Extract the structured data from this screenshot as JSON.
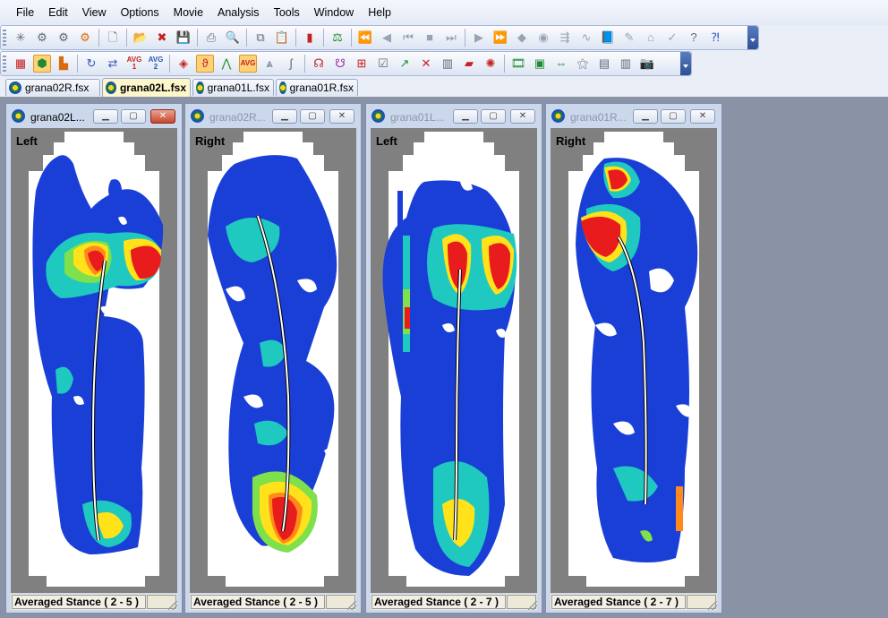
{
  "menu": [
    "File",
    "Edit",
    "View",
    "Options",
    "Movie",
    "Analysis",
    "Tools",
    "Window",
    "Help"
  ],
  "toolbar1": [
    {
      "icon": "asterisk-icon",
      "glyph": "✳",
      "cls": "ic-grey"
    },
    {
      "icon": "gears-icon",
      "glyph": "⚙",
      "cls": "ic-grey"
    },
    {
      "icon": "gear-settings-icon",
      "glyph": "⚙",
      "cls": "ic-grey"
    },
    {
      "icon": "key-gear-icon",
      "glyph": "⚙",
      "cls": "ic-org"
    },
    {
      "sep": true
    },
    {
      "icon": "new-file-icon",
      "glyph": "🗋",
      "cls": "ic-grey"
    },
    {
      "sep": true
    },
    {
      "icon": "open-folder-icon",
      "glyph": "📂",
      "cls": "ic-org"
    },
    {
      "icon": "close-file-icon",
      "glyph": "✖",
      "cls": "ic-red"
    },
    {
      "icon": "save-icon",
      "glyph": "💾",
      "cls": "ic-dis"
    },
    {
      "sep": true
    },
    {
      "icon": "print-icon",
      "glyph": "⎙",
      "cls": "ic-grey"
    },
    {
      "icon": "print-preview-icon",
      "glyph": "🔍",
      "cls": "ic-grey"
    },
    {
      "sep": true
    },
    {
      "icon": "copy-icon",
      "glyph": "⧉",
      "cls": "ic-grey"
    },
    {
      "icon": "paste-icon",
      "glyph": "📋",
      "cls": "ic-org"
    },
    {
      "sep": true
    },
    {
      "icon": "color-scale-icon",
      "glyph": "▮",
      "cls": "ic-red"
    },
    {
      "sep": true
    },
    {
      "icon": "calibrate-icon",
      "glyph": "⚖",
      "cls": "ic-grn"
    },
    {
      "sep": true
    },
    {
      "icon": "rewind-fast-icon",
      "glyph": "⏪",
      "cls": "ic-dis"
    },
    {
      "icon": "step-back-icon",
      "glyph": "◀",
      "cls": "ic-dis"
    },
    {
      "icon": "go-start-icon",
      "glyph": "⏮",
      "cls": "ic-dis"
    },
    {
      "icon": "stop-icon",
      "glyph": "■",
      "cls": "ic-dis"
    },
    {
      "icon": "go-end-icon",
      "glyph": "⏭",
      "cls": "ic-dis"
    },
    {
      "sep": true
    },
    {
      "icon": "play-icon",
      "glyph": "▶",
      "cls": "ic-dis"
    },
    {
      "icon": "fast-forward-icon",
      "glyph": "⏩",
      "cls": "ic-dis"
    },
    {
      "icon": "marker-icon",
      "glyph": "◆",
      "cls": "ic-dis"
    },
    {
      "icon": "camera-record-icon",
      "glyph": "◉",
      "cls": "ic-dis"
    },
    {
      "icon": "split-arrows-icon",
      "glyph": "⇶",
      "cls": "ic-dis"
    },
    {
      "icon": "curve-icon",
      "glyph": "∿",
      "cls": "ic-dis"
    },
    {
      "icon": "book-icon",
      "glyph": "📘",
      "cls": "ic-dis"
    },
    {
      "icon": "edit-sheet-icon",
      "glyph": "✎",
      "cls": "ic-dis"
    },
    {
      "icon": "house-icon",
      "glyph": "⌂",
      "cls": "ic-dis"
    },
    {
      "icon": "check-sheet-icon",
      "glyph": "✓",
      "cls": "ic-dis"
    },
    {
      "icon": "help-icon",
      "glyph": "?",
      "cls": "ic-grey"
    },
    {
      "icon": "context-help-icon",
      "glyph": "⁈",
      "cls": "ic-blue"
    }
  ],
  "toolbar2": [
    {
      "icon": "display-2d-icon",
      "glyph": "▦",
      "cls": "ic-red"
    },
    {
      "icon": "contour-display-icon",
      "glyph": "⬢",
      "cls": "ic-grn",
      "active": true
    },
    {
      "icon": "3d-display-icon",
      "glyph": "▙",
      "cls": "ic-org"
    },
    {
      "sep": true
    },
    {
      "icon": "refresh-icon",
      "glyph": "↻",
      "cls": "ic-blue"
    },
    {
      "icon": "swap-arrows-icon",
      "glyph": "⇄",
      "cls": "ic-blue"
    },
    {
      "icon": "average-1-icon",
      "text": "AVG\n1",
      "cls": "red"
    },
    {
      "icon": "average-2-icon",
      "text": "AVG\n2",
      "cls": ""
    },
    {
      "sep": true
    },
    {
      "icon": "diamond-icon",
      "glyph": "◈",
      "cls": "ic-red"
    },
    {
      "icon": "foot-trace-icon",
      "glyph": "ϑ",
      "cls": "ic-red",
      "active": true
    },
    {
      "icon": "peak-icon",
      "glyph": "⋀",
      "cls": "ic-grn"
    },
    {
      "icon": "average-display-icon",
      "text": "AVG",
      "cls": "red",
      "active": true
    },
    {
      "icon": "triangles-icon",
      "glyph": "⩓",
      "cls": "ic-grey"
    },
    {
      "icon": "integral-icon",
      "glyph": "∫",
      "cls": "ic-grey"
    },
    {
      "sep": true
    },
    {
      "icon": "foot-pair-icon",
      "glyph": "☊",
      "cls": "ic-red"
    },
    {
      "icon": "foot-outline-icon",
      "glyph": "☋",
      "cls": "ic-pur"
    },
    {
      "icon": "grid-icon",
      "glyph": "⊞",
      "cls": "ic-red"
    },
    {
      "icon": "graph-icon",
      "glyph": "☑",
      "cls": "ic-grey"
    },
    {
      "icon": "chart-arrow-icon",
      "glyph": "↗",
      "cls": "ic-grn"
    },
    {
      "icon": "cross-icon",
      "glyph": "✕",
      "cls": "ic-red"
    },
    {
      "icon": "bar-chart-icon",
      "glyph": "▥",
      "cls": "ic-grey"
    },
    {
      "icon": "shoe-icon",
      "glyph": "▰",
      "cls": "ic-red"
    },
    {
      "icon": "signal-icon",
      "glyph": "✺",
      "cls": "ic-red"
    },
    {
      "sep": true
    },
    {
      "icon": "film-icon",
      "glyph": "🎞",
      "cls": "ic-grn"
    },
    {
      "icon": "film-sequence-icon",
      "glyph": "▣",
      "cls": "ic-grn"
    },
    {
      "icon": "film-compare-icon",
      "glyph": "⇔",
      "cls": "ic-grn"
    },
    {
      "icon": "wand-icon",
      "glyph": "⚝",
      "cls": "ic-grey"
    },
    {
      "icon": "tile-horizontal-icon",
      "glyph": "▤",
      "cls": "ic-grey"
    },
    {
      "icon": "tile-vertical-icon",
      "glyph": "▥",
      "cls": "ic-grey"
    },
    {
      "icon": "snapshot-camera-icon",
      "glyph": "📷",
      "cls": "ic-grey"
    }
  ],
  "tabs": [
    {
      "label": "grana02R.fsx",
      "active": false
    },
    {
      "label": "grana02L.fsx",
      "active": true
    },
    {
      "label": "grana01L.fsx",
      "active": false
    },
    {
      "label": "grana01R.fsx",
      "active": false
    }
  ],
  "windows": [
    {
      "title": "grana02L...",
      "side": "Left",
      "status": "Averaged Stance ( 2 - 5 )",
      "active": true
    },
    {
      "title": "grana02R...",
      "side": "Right",
      "status": "Averaged Stance ( 2 - 5 )",
      "active": false
    },
    {
      "title": "grana01L...",
      "side": "Left",
      "status": "Averaged Stance ( 2 - 7 )",
      "active": false
    },
    {
      "title": "grana01R...",
      "side": "Right",
      "status": "Averaged Stance ( 2 - 7 )",
      "active": false
    }
  ],
  "colors": {
    "low": "#1a3fd6",
    "mid": "#1fc9c0",
    "high": "#ffe21a",
    "peak": "#e81c1c",
    "sensor_off": "#ffffff",
    "background": "#808080"
  }
}
